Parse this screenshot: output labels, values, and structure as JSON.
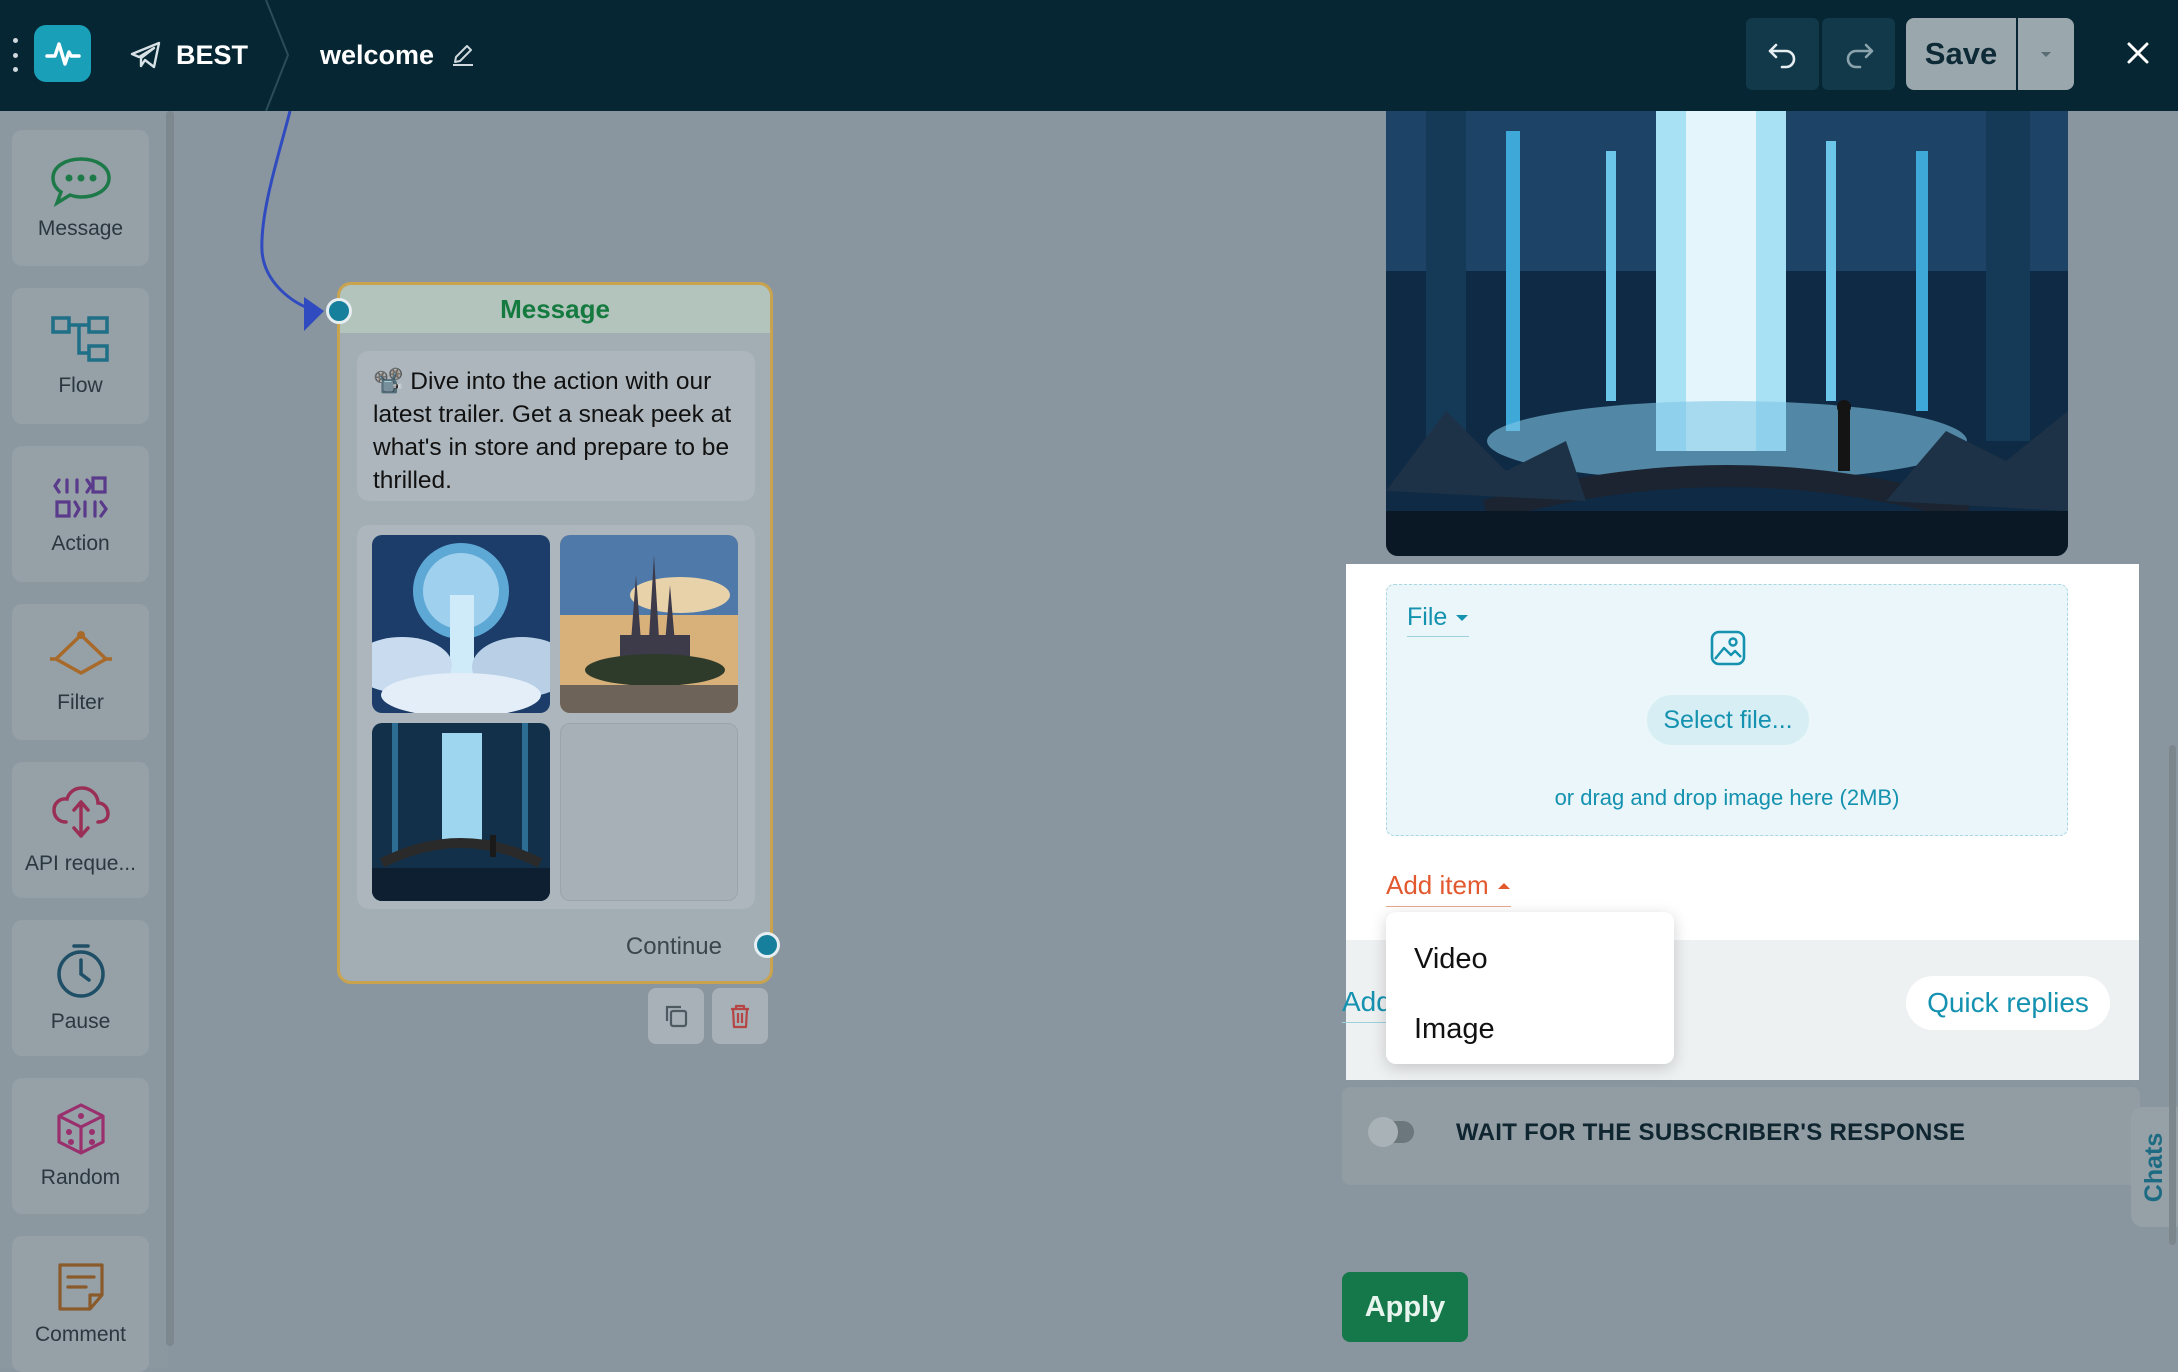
{
  "header": {
    "bot_name": "BEST",
    "flow_name": "welcome",
    "save_label": "Save"
  },
  "sidebar": {
    "items": [
      {
        "label": "Message",
        "icon": "chat-bubble-icon"
      },
      {
        "label": "Flow",
        "icon": "flow-icon"
      },
      {
        "label": "Action",
        "icon": "action-icon"
      },
      {
        "label": "Filter",
        "icon": "filter-icon"
      },
      {
        "label": "API reque...",
        "icon": "cloud-api-icon"
      },
      {
        "label": "Pause",
        "icon": "timer-icon"
      },
      {
        "label": "Random",
        "icon": "dice-icon"
      },
      {
        "label": "Comment",
        "icon": "comment-icon"
      }
    ]
  },
  "node": {
    "title": "Message",
    "text": "📽️ Dive into the action with our latest trailer. Get a sneak peek at what's in store and prepare to be thrilled.",
    "continue_label": "Continue"
  },
  "panel": {
    "file_select_label": "File",
    "select_file_label": "Select file...",
    "drop_hint": "or drag and drop image here (2MB)",
    "add_item_label": "Add item",
    "add_link_label": "Add",
    "quick_replies_label": "Quick replies",
    "menu": {
      "items": [
        "Video",
        "Image"
      ]
    },
    "wait_label": "WAIT FOR THE SUBSCRIBER'S RESPONSE",
    "wait_enabled": false,
    "apply_label": "Apply",
    "chats_tab_label": "Chats"
  },
  "colors": {
    "topbar": "#052632",
    "accent": "#1592b0",
    "add_item": "#e2592f",
    "apply": "#15784a",
    "node_title": "#157a3f"
  }
}
